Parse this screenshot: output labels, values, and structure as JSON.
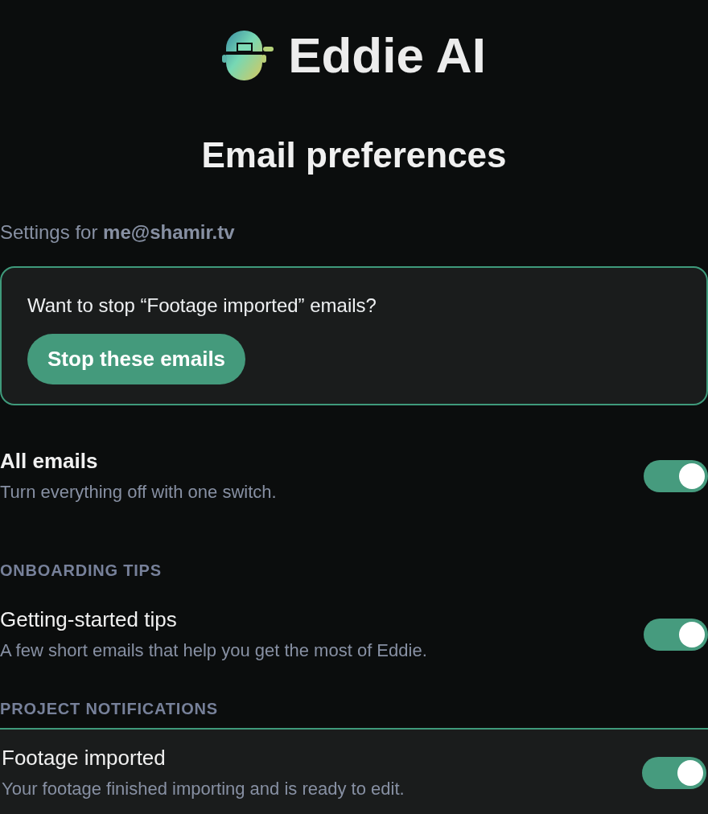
{
  "logo": {
    "text": "Eddie AI"
  },
  "title": "Email preferences",
  "account_line": "Settings for **me@shamir.tv**",
  "notice": {
    "message": "Want to stop “Footage imported” emails?",
    "button": "Stop these emails"
  },
  "master": {
    "title": "All emails",
    "description": "Turn everything off with one switch.",
    "on": true
  },
  "sections": [
    {
      "heading": "ONBOARDING TIPS",
      "items": [
        {
          "title": "Getting-started tips",
          "description": "A few short emails that help you get the most of Eddie.",
          "on": true,
          "highlighted": false
        }
      ]
    },
    {
      "heading": "PROJECT NOTIFICATIONS",
      "items": [
        {
          "title": "Footage imported",
          "description": "Your footage finished importing and is ready to edit.",
          "on": true,
          "highlighted": true
        }
      ]
    }
  ]
}
